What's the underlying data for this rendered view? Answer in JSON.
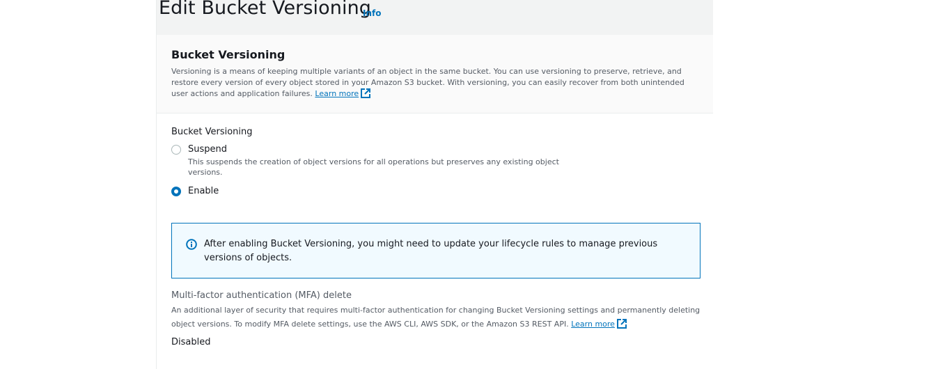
{
  "header": {
    "title": "Edit Bucket Versioning",
    "info_link": "Info"
  },
  "section": {
    "title": "Bucket Versioning",
    "description": "Versioning is a means of keeping multiple variants of an object in the same bucket. You can use versioning to preserve, retrieve, and restore every version of every object stored in your Amazon S3 bucket. With versioning, you can easily recover from both unintended user actions and application failures.",
    "learn_more": "Learn more"
  },
  "versioning": {
    "label": "Bucket Versioning",
    "options": [
      {
        "label": "Suspend",
        "description": "This suspends the creation of object versions for all operations but preserves any existing object versions.",
        "selected": false
      },
      {
        "label": "Enable",
        "selected": true
      }
    ]
  },
  "alert": {
    "icon": "info-circle-icon",
    "text": "After enabling Bucket Versioning, you might need to update your lifecycle rules to manage previous versions of objects."
  },
  "mfa": {
    "title": "Multi-factor authentication (MFA) delete",
    "description": "An additional layer of security that requires multi-factor authentication for changing Bucket Versioning settings and permanently deleting object versions. To modify MFA delete settings, use the AWS CLI, AWS SDK, or the Amazon S3 REST API.",
    "learn_more": "Learn more",
    "value": "Disabled"
  },
  "colors": {
    "accent": "#0073bb",
    "alert_bg": "#f1faff",
    "header_bg": "#f2f3f3"
  }
}
